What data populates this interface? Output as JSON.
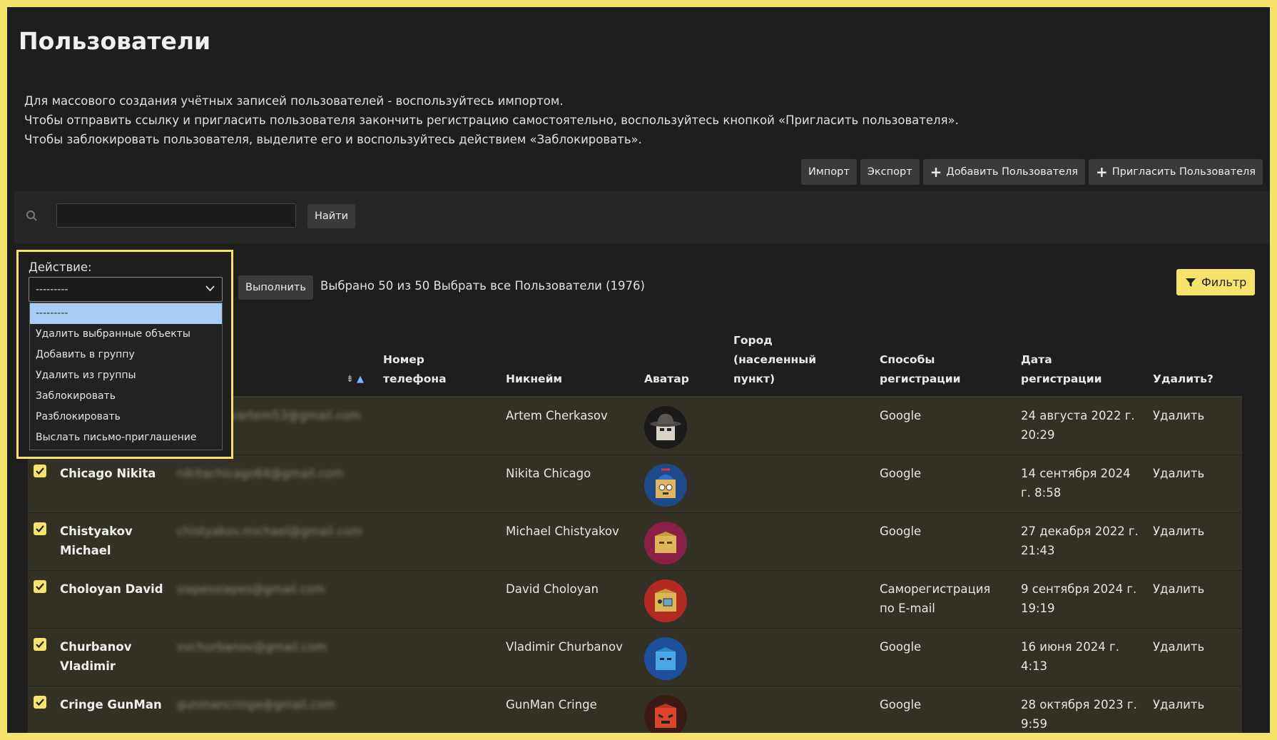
{
  "page": {
    "title": "Пользователи"
  },
  "intro": [
    "Для массового создания учётных записей пользователей - воспользуйтесь импортом.",
    "Чтобы отправить ссылку и пригласить пользователя закончить регистрацию самостоятельно, воспользуйтесь кнопкой «Пригласить пользователя».",
    "Чтобы заблокировать пользователя, выделите его и воспользуйтесь действием «Заблокировать»."
  ],
  "toolbar": {
    "import": "Импорт",
    "export": "Экспорт",
    "add_user": "Добавить Пользователя",
    "invite_user": "Пригласить Пользователя"
  },
  "search": {
    "value": "",
    "button": "Найти"
  },
  "actions": {
    "label": "Действие:",
    "selected": "---------",
    "options": [
      "---------",
      "Удалить выбранные объекты",
      "Добавить в группу",
      "Удалить из группы",
      "Заблокировать",
      "Разблокировать",
      "Выслать письмо-приглашение"
    ],
    "execute": "Выполнить",
    "selection_info": "Выбрано 50 из 50 Выбрать все Пользователи (1976)"
  },
  "filter": {
    "label": "Фильтр"
  },
  "colors": {
    "accent": "#f5e36b",
    "background": "#1e1e1e",
    "row": "#333126",
    "selected_option": "#a8cdf7"
  },
  "table": {
    "headers": {
      "phone": "Номер телефона",
      "nickname": "Никнейм",
      "avatar": "Аватар",
      "city": "Город (населенный пункт)",
      "methods": "Способы регистрации",
      "date": "Дата регистрации",
      "delete": "Удалить?"
    },
    "rows": [
      {
        "name": "",
        "email": "cherkasovartem53@gmail.com",
        "nickname": "Artem Cherkasov",
        "avatar": "fedora-hat-character",
        "method": "Google",
        "date": "24 августа 2022 г. 20:29",
        "delete": "Удалить"
      },
      {
        "name": "Chicago Nikita",
        "email": "nikitachicago64@gmail.com",
        "nickname": "Nikita Chicago",
        "avatar": "propeller-cap-box",
        "method": "Google",
        "date": "14 сентября 2024 г. 8:58",
        "delete": "Удалить"
      },
      {
        "name": "Chistyakov Michael",
        "email": "chistyakov.michael@gmail.com",
        "nickname": "Michael Chistyakov",
        "avatar": "box-character",
        "method": "Google",
        "date": "27 декабря 2022 г. 21:43",
        "delete": "Удалить"
      },
      {
        "name": "Choloyan David",
        "email": "siapessiapes@gmail.com",
        "nickname": "David Choloyan",
        "avatar": "box-character-red",
        "method": "Саморегистрация по E-mail",
        "date": "9 сентября 2024 г. 19:19",
        "delete": "Удалить"
      },
      {
        "name": "Churbanov Vladimir",
        "email": "vvchurbanov@gmail.com",
        "nickname": "Vladimir Churbanov",
        "avatar": "blue-box",
        "method": "Google",
        "date": "16 июня 2024 г. 4:13",
        "delete": "Удалить"
      },
      {
        "name": "Cringe GunMan",
        "email": "gunmancringe@gmail.com",
        "nickname": "GunMan Cringe",
        "avatar": "angry-red-box",
        "method": "Google",
        "date": "28 октября 2023 г. 9:59",
        "delete": "Удалить"
      }
    ]
  }
}
